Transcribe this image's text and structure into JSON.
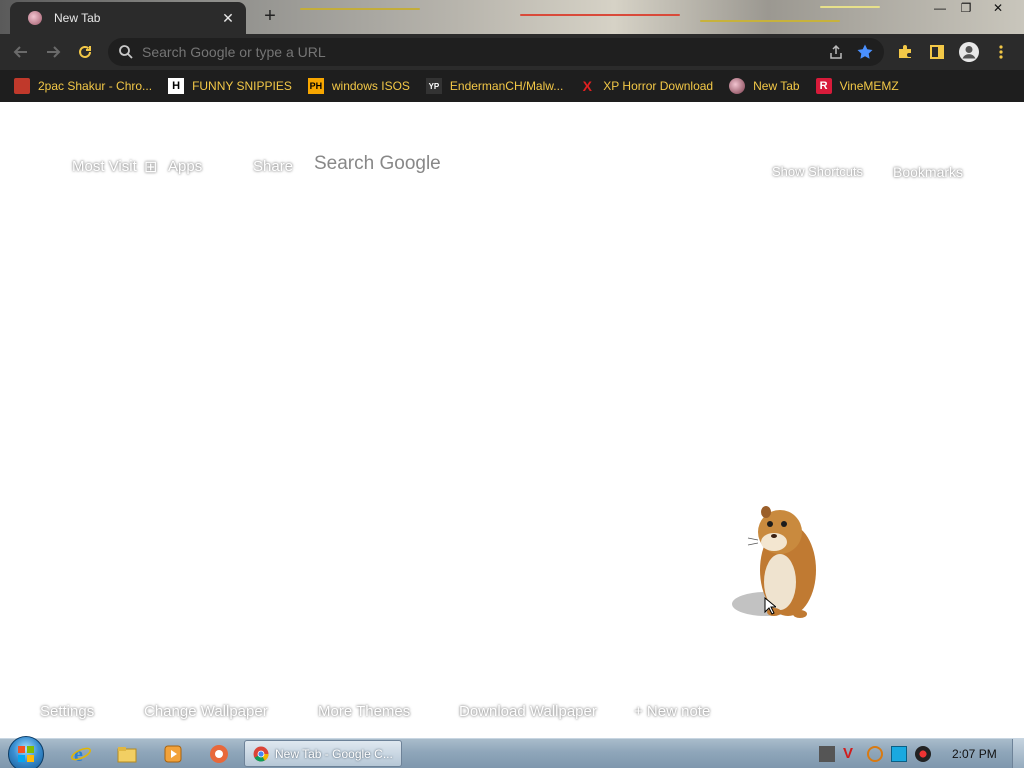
{
  "browser": {
    "tab": {
      "title": "New Tab",
      "close_glyph": "✕"
    },
    "new_tab_glyph": "+",
    "window_controls": {
      "minimize": "—",
      "restore": "❐",
      "close": "✕"
    },
    "omnibox": {
      "placeholder": "Search Google or type a URL",
      "value": ""
    },
    "bookmarks": [
      {
        "label": "2pac Shakur - Chro...",
        "icon": "bookmark-2pac-icon",
        "icon_color": "#c0392b"
      },
      {
        "label": "FUNNY SNIPPIES",
        "icon": "bookmark-h-icon",
        "icon_text": "H",
        "icon_color": "#ffffff"
      },
      {
        "label": "windows ISOS",
        "icon": "bookmark-ph-icon",
        "icon_text": "PH",
        "icon_color": "#f7a600"
      },
      {
        "label": "EndermanCH/Malw...",
        "icon": "bookmark-yp-icon",
        "icon_text": "YP",
        "icon_color": "#333333"
      },
      {
        "label": "XP Horror Download",
        "icon": "bookmark-x-icon",
        "icon_text": "X",
        "icon_color": "#e02020"
      },
      {
        "label": "New Tab",
        "icon": "bookmark-newtab-icon",
        "icon_color": "#b06070"
      },
      {
        "label": "VineMEMZ",
        "icon": "bookmark-r-icon",
        "icon_text": "R",
        "icon_color": "#d81b3a"
      }
    ],
    "bookmark_text_color": "#f3c847",
    "accent_star_color": "#4a90ff"
  },
  "newtab": {
    "top_links": [
      {
        "label": "Most Visit",
        "name": "most-visited-link"
      },
      {
        "label": "Apps",
        "name": "apps-link"
      },
      {
        "label": "Share",
        "name": "share-link"
      }
    ],
    "search_label": "Search Google",
    "right_links": [
      {
        "label": "Show Shortcuts",
        "name": "show-shortcuts-link"
      },
      {
        "label": "Bookmarks",
        "name": "bookmarks-link"
      }
    ],
    "bottom_links": [
      {
        "label": "Settings",
        "name": "settings-link"
      },
      {
        "label": "Change Wallpaper",
        "name": "change-wallpaper-link"
      },
      {
        "label": "More Themes",
        "name": "more-themes-link"
      },
      {
        "label": "Download Wallpaper",
        "name": "download-wallpaper-link"
      },
      {
        "label": "+ New note",
        "name": "new-note-link"
      }
    ],
    "mascot": "hamster-image"
  },
  "taskbar": {
    "start": "start-button",
    "pinned": [
      "internet-explorer-icon",
      "file-explorer-icon",
      "media-player-icon",
      "app-icon"
    ],
    "active_window": {
      "label": "New Tab - Google C..."
    },
    "clock": "2:07 PM"
  }
}
